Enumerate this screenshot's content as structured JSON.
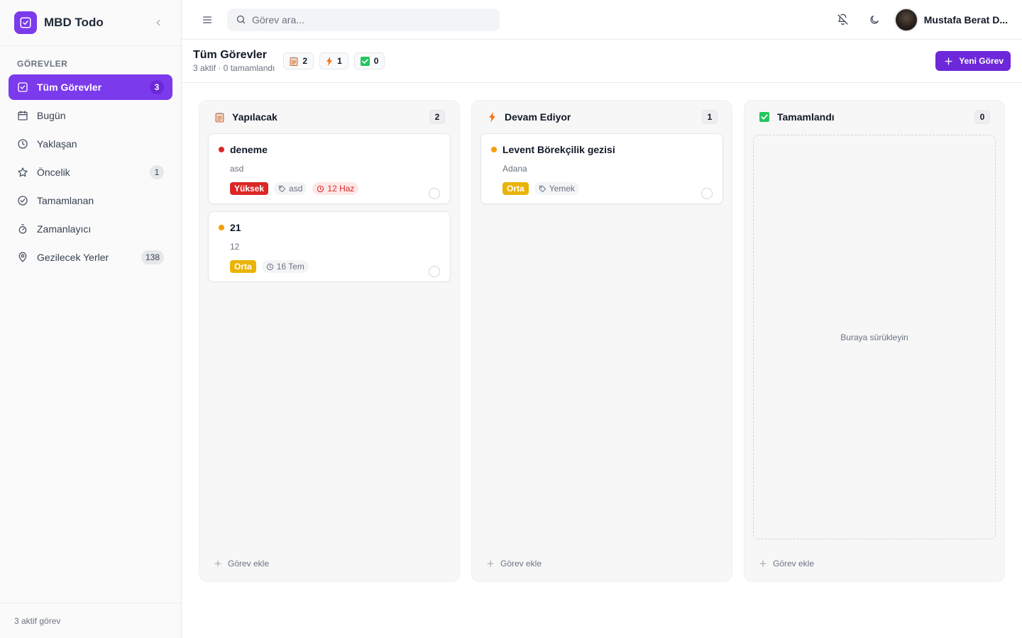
{
  "brand": {
    "name": "MBD Todo"
  },
  "sidebar": {
    "section_title": "GÖREVLER",
    "items": [
      {
        "label": "Tüm Görevler",
        "count": "3",
        "icon": "check-square-icon",
        "active": true
      },
      {
        "label": "Bugün",
        "count": "",
        "icon": "calendar-icon"
      },
      {
        "label": "Yaklaşan",
        "count": "",
        "icon": "clock-icon"
      },
      {
        "label": "Öncelik",
        "count": "1",
        "icon": "star-icon"
      },
      {
        "label": "Tamamlanan",
        "count": "",
        "icon": "check-circle-icon"
      },
      {
        "label": "Zamanlayıcı",
        "count": "",
        "icon": "timer-icon"
      },
      {
        "label": "Gezilecek Yerler",
        "count": "138",
        "icon": "map-pin-icon"
      }
    ],
    "footer": "3 aktif görev"
  },
  "topbar": {
    "search_placeholder": "Görev ara...",
    "user_name": "Mustafa Berat D..."
  },
  "page": {
    "title": "Tüm Görevler",
    "subtitle": "3 aktif · 0 tamamlandı",
    "stats": {
      "todo": "2",
      "progress": "1",
      "done": "0"
    },
    "new_button": "Yeni Görev"
  },
  "colors": {
    "accent": "#7c3aed",
    "high": "#dc2626",
    "medium": "#eab308",
    "medium_dot": "#f59e0b",
    "done_green": "#22c55e",
    "bolt_orange": "#f97316"
  },
  "columns": {
    "todo": {
      "title": "Yapılacak",
      "count": "2",
      "cards": [
        {
          "title": "deneme",
          "desc": "asd",
          "priority": "Yüksek",
          "tag": "asd",
          "date": "12 Haz"
        },
        {
          "title": "21",
          "desc": "12",
          "priority": "Orta",
          "date": "16 Tem"
        }
      ],
      "add_label": "Görev ekle"
    },
    "progress": {
      "title": "Devam Ediyor",
      "count": "1",
      "cards": [
        {
          "title": "Levent Börekçilik gezisi",
          "desc": "Adana",
          "priority": "Orta",
          "tag": "Yemek"
        }
      ],
      "add_label": "Görev ekle"
    },
    "done": {
      "title": "Tamamlandı",
      "count": "0",
      "empty_text": "Buraya sürükleyin",
      "add_label": "Görev ekle"
    }
  }
}
